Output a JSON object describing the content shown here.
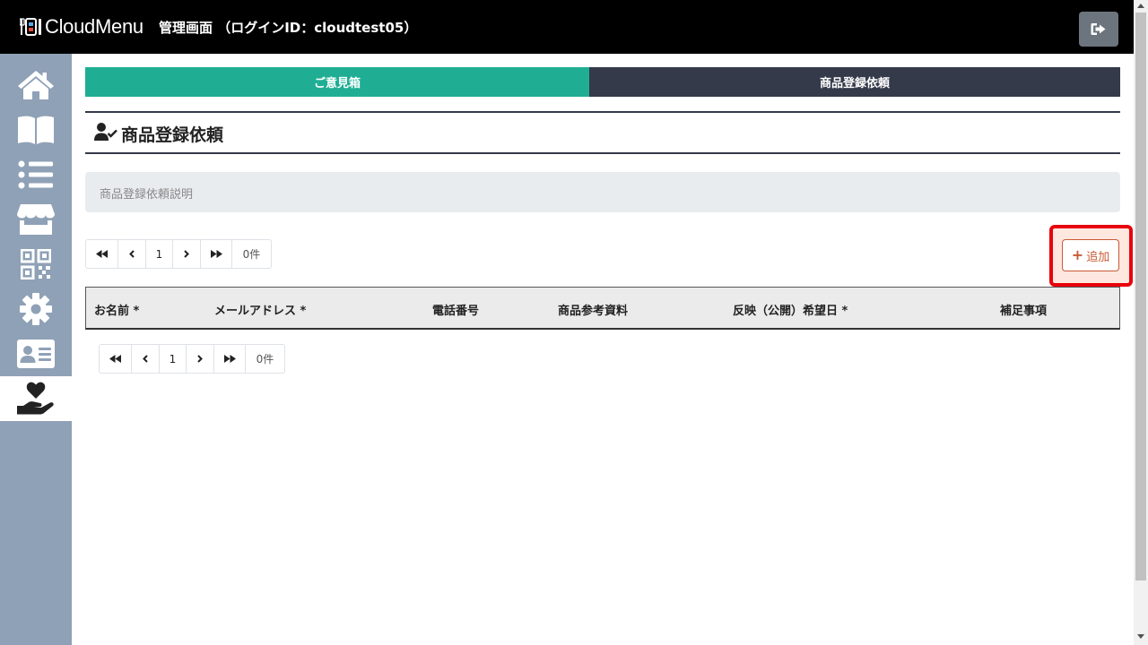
{
  "header": {
    "logo_text": "CloudMenu",
    "admin_title": "管理画面 （ログインID：cloudtest05）",
    "logout_icon": "sign-out-icon"
  },
  "sidebar": {
    "items": [
      {
        "icon": "home-icon"
      },
      {
        "icon": "book-open-icon"
      },
      {
        "icon": "list-icon"
      },
      {
        "icon": "store-icon"
      },
      {
        "icon": "qrcode-icon"
      },
      {
        "icon": "gear-icon"
      },
      {
        "icon": "id-card-icon"
      },
      {
        "icon": "hand-holding-heart-icon",
        "active": true
      }
    ]
  },
  "tabs": [
    {
      "label": "ご意見箱"
    },
    {
      "label": "商品登録依頼"
    }
  ],
  "page": {
    "heading": "商品登録依頼",
    "heading_icon": "user-check-icon",
    "description": "商品登録依頼説明"
  },
  "pagination": {
    "current_page": "1",
    "count": "0件"
  },
  "add_button": {
    "label": "追加",
    "icon": "plus-icon"
  },
  "table": {
    "columns": [
      "お名前 *",
      "メールアドレス *",
      "電話番号",
      "商品参考資料",
      "反映（公開）希望日 *",
      "補足事項"
    ]
  },
  "colors": {
    "topbar": "#000000",
    "sidebar": "#8fa1b6",
    "tab_active": "#1fae94",
    "tab_inactive": "#343a4a",
    "add_button": "#c95a35",
    "highlight": "#e8000b"
  }
}
